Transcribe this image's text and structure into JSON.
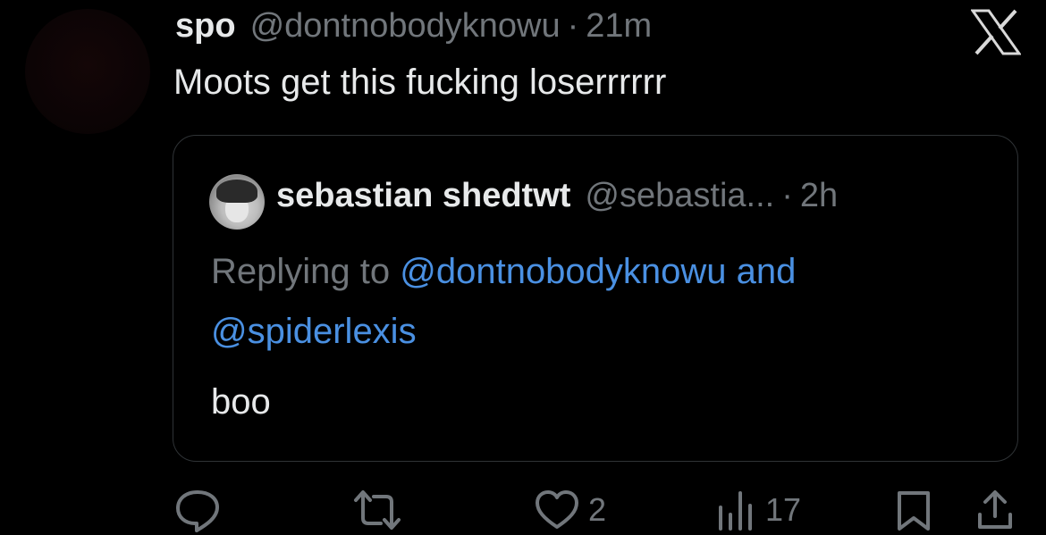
{
  "tweet": {
    "display_name": "spo",
    "handle": "@dontnobodyknowu",
    "separator": "·",
    "time": "21m",
    "text": "Moots get this fucking loserrrrrr"
  },
  "quoted_tweet": {
    "display_name": "sebastian shedtwt",
    "handle": "@sebastia...",
    "separator": "·",
    "time": "2h",
    "replying_prefix": "Replying to ",
    "replying_mention_1": "@dontnobodyknowu",
    "replying_joiner": " and",
    "replying_mention_2": "@spiderlexis",
    "text": "boo"
  },
  "actions": {
    "reply_icon": "reply-icon",
    "retweet_icon": "retweet-icon",
    "like_icon": "heart-icon",
    "like_count": "2",
    "views_icon": "views-icon",
    "views_count": "17",
    "bookmark_icon": "bookmark-icon",
    "share_icon": "share-icon"
  },
  "colors": {
    "background": "#000000",
    "text_primary": "#e7e9ea",
    "text_secondary": "#71767b",
    "link": "#4a90e2",
    "border": "#2f3336"
  },
  "platform_logo": "x-logo-icon"
}
